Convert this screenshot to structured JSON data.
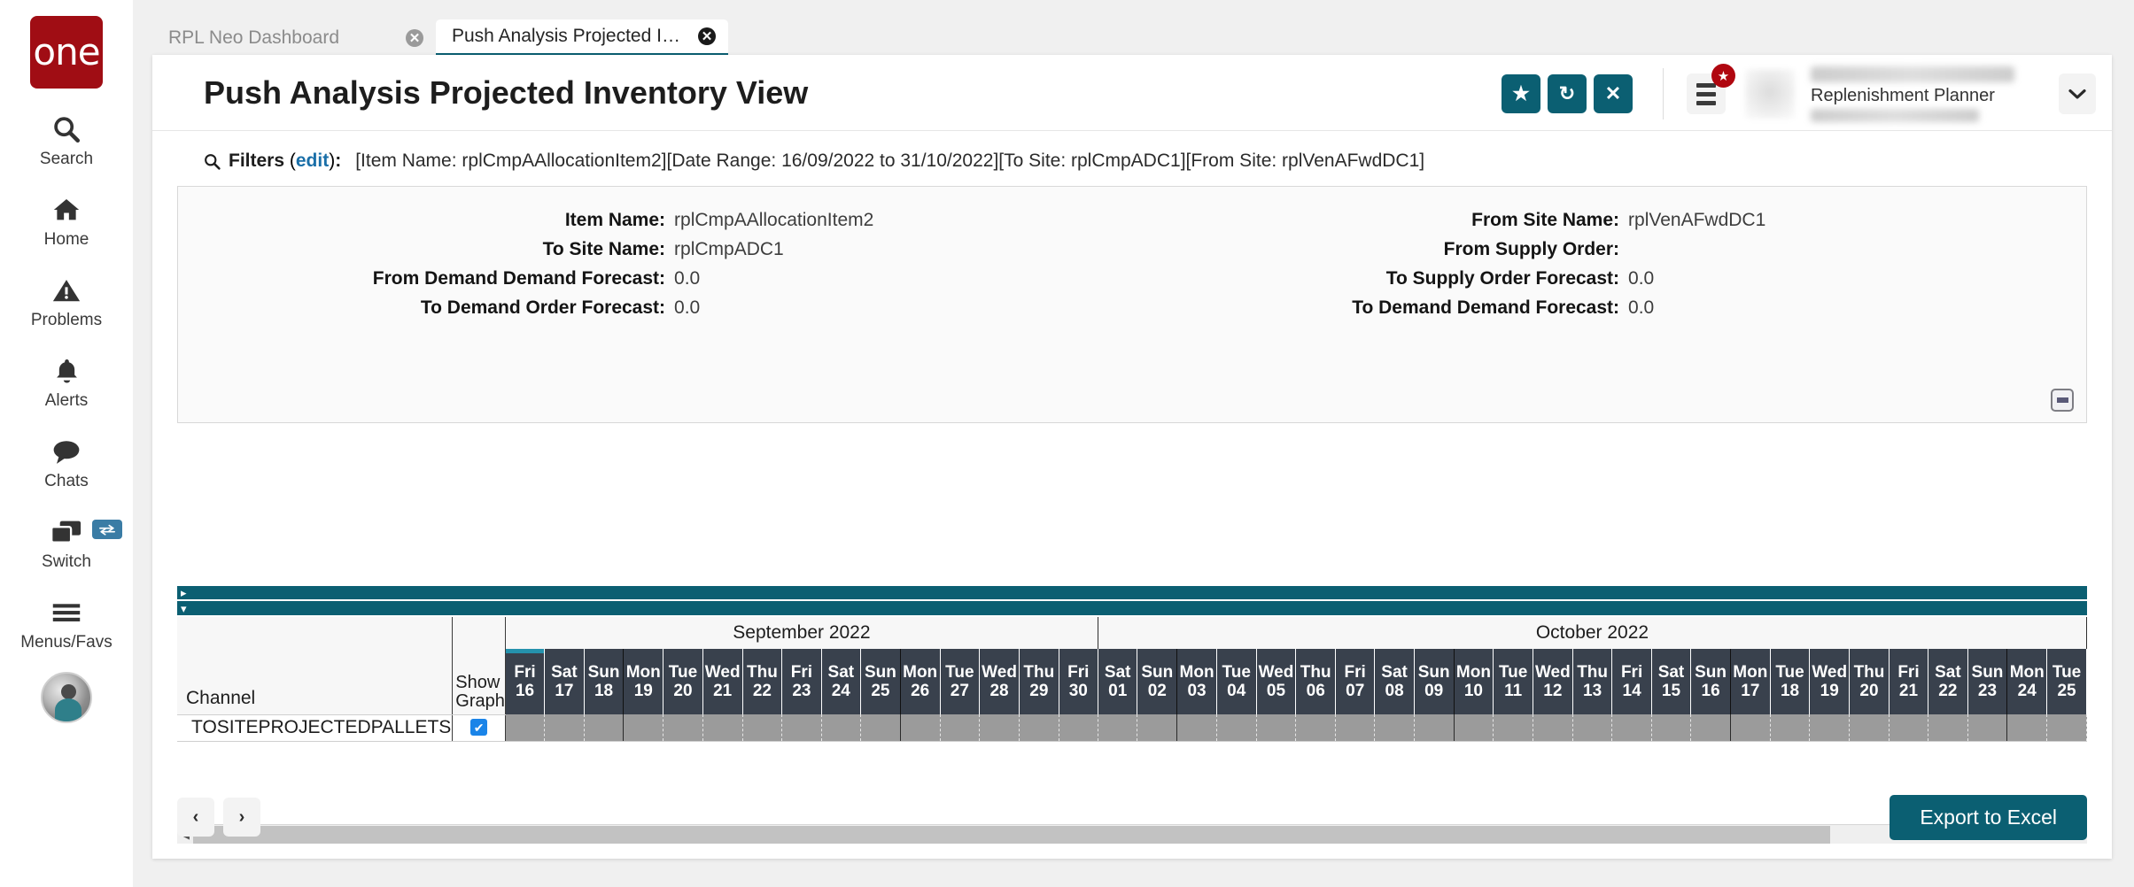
{
  "rail": {
    "logo_text": "one",
    "items": [
      {
        "label": "Search",
        "icon": "search-icon"
      },
      {
        "label": "Home",
        "icon": "home-icon"
      },
      {
        "label": "Problems",
        "icon": "warning-triangle-icon"
      },
      {
        "label": "Alerts",
        "icon": "bell-icon"
      },
      {
        "label": "Chats",
        "icon": "chat-bubble-icon"
      },
      {
        "label": "Switch",
        "icon": "switch-windows-icon"
      },
      {
        "label": "Menus/Favs",
        "icon": "hamburger-icon"
      }
    ]
  },
  "tabs": [
    {
      "label": "RPL Neo Dashboard",
      "active": false
    },
    {
      "label": "Push Analysis Projected Inventor...",
      "active": true
    }
  ],
  "header": {
    "title": "Push Analysis Projected Inventory View",
    "favorite_label": "★",
    "refresh_label": "↻",
    "close_label": "✕",
    "menu_badge": "★",
    "user_role": "Replenishment Planner",
    "user_caret": "❯"
  },
  "filters": {
    "label": "Filters",
    "edit_label": "edit",
    "colon": ":",
    "summary": "[Item Name: rplCmpAAllocationItem2][Date Range: 16/09/2022 to 31/10/2022][To Site: rplCmpADC1][From Site: rplVenAFwdDC1]",
    "left_rows": [
      {
        "key": "Item Name:",
        "value": "rplCmpAAllocationItem2"
      },
      {
        "key": "To Site Name:",
        "value": "rplCmpADC1"
      },
      {
        "key": "From Demand Demand Forecast:",
        "value": "0.0"
      },
      {
        "key": "To Demand Order Forecast:",
        "value": "0.0"
      }
    ],
    "right_rows": [
      {
        "key": "From Site Name:",
        "value": "rplVenAFwdDC1"
      },
      {
        "key": "From Supply Order:",
        "value": ""
      },
      {
        "key": "To Supply Order Forecast:",
        "value": "0.0"
      },
      {
        "key": "To Demand Demand Forecast:",
        "value": "0.0"
      }
    ]
  },
  "grid": {
    "col_channel": "Channel",
    "col_show_graph": "Show Graph",
    "months": [
      {
        "label": "September 2022",
        "span": 15
      },
      {
        "label": "October 2022",
        "span": 25
      }
    ],
    "days": [
      {
        "dow": "Fri",
        "dom": "16",
        "today": true,
        "week_start": false
      },
      {
        "dow": "Sat",
        "dom": "17",
        "today": false,
        "week_start": false
      },
      {
        "dow": "Sun",
        "dom": "18",
        "today": false,
        "week_start": false
      },
      {
        "dow": "Mon",
        "dom": "19",
        "today": false,
        "week_start": true
      },
      {
        "dow": "Tue",
        "dom": "20",
        "today": false,
        "week_start": false
      },
      {
        "dow": "Wed",
        "dom": "21",
        "today": false,
        "week_start": false
      },
      {
        "dow": "Thu",
        "dom": "22",
        "today": false,
        "week_start": false
      },
      {
        "dow": "Fri",
        "dom": "23",
        "today": false,
        "week_start": false
      },
      {
        "dow": "Sat",
        "dom": "24",
        "today": false,
        "week_start": false
      },
      {
        "dow": "Sun",
        "dom": "25",
        "today": false,
        "week_start": false
      },
      {
        "dow": "Mon",
        "dom": "26",
        "today": false,
        "week_start": true
      },
      {
        "dow": "Tue",
        "dom": "27",
        "today": false,
        "week_start": false
      },
      {
        "dow": "Wed",
        "dom": "28",
        "today": false,
        "week_start": false
      },
      {
        "dow": "Thu",
        "dom": "29",
        "today": false,
        "week_start": false
      },
      {
        "dow": "Fri",
        "dom": "30",
        "today": false,
        "week_start": false
      },
      {
        "dow": "Sat",
        "dom": "01",
        "today": false,
        "week_start": false
      },
      {
        "dow": "Sun",
        "dom": "02",
        "today": false,
        "week_start": false
      },
      {
        "dow": "Mon",
        "dom": "03",
        "today": false,
        "week_start": true
      },
      {
        "dow": "Tue",
        "dom": "04",
        "today": false,
        "week_start": false
      },
      {
        "dow": "Wed",
        "dom": "05",
        "today": false,
        "week_start": false
      },
      {
        "dow": "Thu",
        "dom": "06",
        "today": false,
        "week_start": false
      },
      {
        "dow": "Fri",
        "dom": "07",
        "today": false,
        "week_start": false
      },
      {
        "dow": "Sat",
        "dom": "08",
        "today": false,
        "week_start": false
      },
      {
        "dow": "Sun",
        "dom": "09",
        "today": false,
        "week_start": false
      },
      {
        "dow": "Mon",
        "dom": "10",
        "today": false,
        "week_start": true
      },
      {
        "dow": "Tue",
        "dom": "11",
        "today": false,
        "week_start": false
      },
      {
        "dow": "Wed",
        "dom": "12",
        "today": false,
        "week_start": false
      },
      {
        "dow": "Thu",
        "dom": "13",
        "today": false,
        "week_start": false
      },
      {
        "dow": "Fri",
        "dom": "14",
        "today": false,
        "week_start": false
      },
      {
        "dow": "Sat",
        "dom": "15",
        "today": false,
        "week_start": false
      },
      {
        "dow": "Sun",
        "dom": "16",
        "today": false,
        "week_start": false
      },
      {
        "dow": "Mon",
        "dom": "17",
        "today": false,
        "week_start": true
      },
      {
        "dow": "Tue",
        "dom": "18",
        "today": false,
        "week_start": false
      },
      {
        "dow": "Wed",
        "dom": "19",
        "today": false,
        "week_start": false
      },
      {
        "dow": "Thu",
        "dom": "20",
        "today": false,
        "week_start": false
      },
      {
        "dow": "Fri",
        "dom": "21",
        "today": false,
        "week_start": false
      },
      {
        "dow": "Sat",
        "dom": "22",
        "today": false,
        "week_start": false
      },
      {
        "dow": "Sun",
        "dom": "23",
        "today": false,
        "week_start": false
      },
      {
        "dow": "Mon",
        "dom": "24",
        "today": false,
        "week_start": true
      },
      {
        "dow": "Tue",
        "dom": "25",
        "today": false,
        "week_start": false
      }
    ],
    "rows": [
      {
        "channel": "TOSITEPROJECTEDPALLETS",
        "show_graph": true,
        "values": []
      }
    ]
  },
  "footer": {
    "prev_label": "‹",
    "next_label": "›",
    "export_label": "Export to Excel"
  },
  "colors": {
    "brand_red": "#a00d14",
    "teal": "#0b5f72",
    "header_dark": "#39414d",
    "cell_gray": "#9b9b9b",
    "today_accent": "#2592ad",
    "checkbox_blue": "#1a84e8",
    "link_blue": "#1a6fa8"
  }
}
